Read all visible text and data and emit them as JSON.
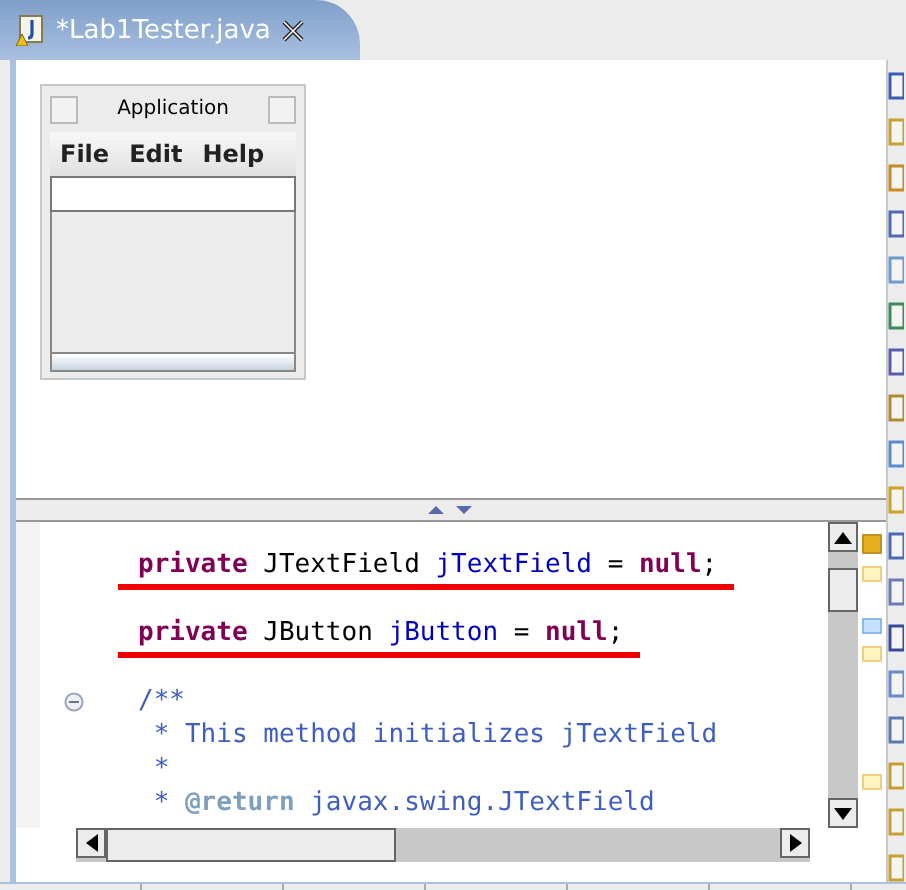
{
  "editor_tab": {
    "title": "*Lab1Tester.java"
  },
  "design_preview": {
    "window_title": "Application",
    "menus": [
      "File",
      "Edit",
      "Help"
    ]
  },
  "code_lines": [
    {
      "underlined": true,
      "folding": false,
      "tokens": [
        {
          "text": "private",
          "kind": "keyword"
        },
        {
          "text": " JTextField ",
          "kind": "plain"
        },
        {
          "text": "jTextField",
          "kind": "field"
        },
        {
          "text": " = ",
          "kind": "plain"
        },
        {
          "text": "null",
          "kind": "keyword"
        },
        {
          "text": ";",
          "kind": "plain"
        }
      ]
    },
    {
      "underlined": true,
      "folding": false,
      "tokens": [
        {
          "text": "private",
          "kind": "keyword"
        },
        {
          "text": " JButton ",
          "kind": "plain"
        },
        {
          "text": "jButton",
          "kind": "field"
        },
        {
          "text": " = ",
          "kind": "plain"
        },
        {
          "text": "null",
          "kind": "keyword"
        },
        {
          "text": ";",
          "kind": "plain"
        }
      ]
    },
    {
      "underlined": false,
      "folding": true,
      "tokens": [
        {
          "text": "/**",
          "kind": "comment"
        }
      ]
    },
    {
      "underlined": false,
      "folding": false,
      "tokens": [
        {
          "text": " * This method initializes jTextField",
          "kind": "comment"
        }
      ]
    },
    {
      "underlined": false,
      "folding": false,
      "tokens": [
        {
          "text": " *",
          "kind": "comment"
        }
      ]
    },
    {
      "underlined": false,
      "folding": false,
      "tokens": [
        {
          "text": " * ",
          "kind": "comment"
        },
        {
          "text": "@return",
          "kind": "doc_tag"
        },
        {
          "text": " javax.swing.JTextField",
          "kind": "comment"
        }
      ]
    }
  ]
}
